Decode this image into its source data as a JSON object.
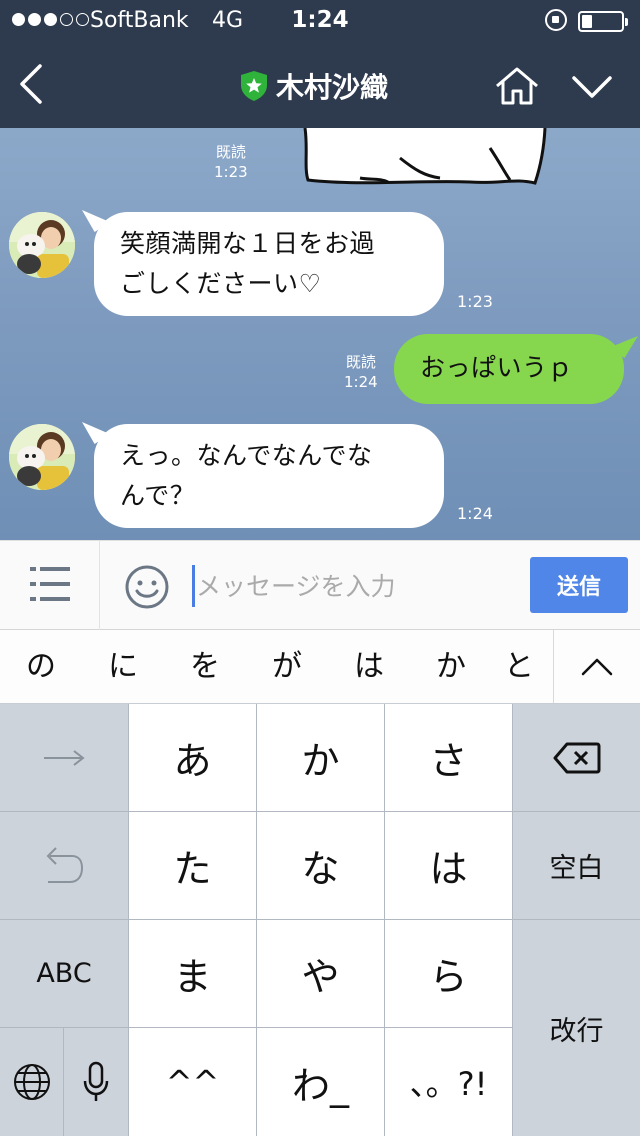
{
  "status_bar": {
    "signal_bars": 5,
    "signal_filled": 3,
    "carrier": "SoftBank",
    "network": "4G",
    "time": "1:24",
    "battery_level": 0.25
  },
  "header": {
    "title": "木村沙織",
    "back_icon": "chevron-left-icon",
    "home_icon": "home-icon",
    "menu_icon": "chevron-down-icon",
    "badge_icon": "shield-star-icon",
    "background": "#2e3a4e"
  },
  "messages": [
    {
      "sender": "self",
      "read_label": "既読",
      "time": "1:23",
      "type": "sticker"
    },
    {
      "sender": "other",
      "text_lines": [
        "笑顔満開な１日をお過",
        "ごしくださーい♡"
      ],
      "time": "1:23"
    },
    {
      "sender": "self",
      "read_label": "既読",
      "text_lines": [
        "おっぱいうｐ"
      ],
      "time": "1:24"
    },
    {
      "sender": "other",
      "text_lines": [
        "えっ。なんでなんでな",
        "んで？"
      ],
      "time": "1:24"
    }
  ],
  "input_bar": {
    "placeholder": "メッセージを入力",
    "send_label": "送信",
    "list_icon": "list-icon",
    "emoji_icon": "smiley-icon",
    "send_color": "#4f86e7"
  },
  "candidates": [
    "の",
    "に",
    "を",
    "が",
    "は",
    "か",
    "と"
  ],
  "keyboard": {
    "rows": [
      [
        "→",
        "あ",
        "か",
        "さ",
        "⌫"
      ],
      [
        "undo",
        "た",
        "な",
        "は",
        "空白"
      ],
      [
        "ABC",
        "ま",
        "や",
        "ら",
        "改行"
      ],
      [
        "globe",
        "mic",
        "^^",
        "わ_",
        "、。?!"
      ]
    ],
    "space_label": "空白",
    "return_label": "改行",
    "abc_label": "ABC"
  },
  "colors": {
    "self_bubble": "#86d64e",
    "other_bubble": "#ffffff",
    "chat_background": "#7e9bbf"
  }
}
